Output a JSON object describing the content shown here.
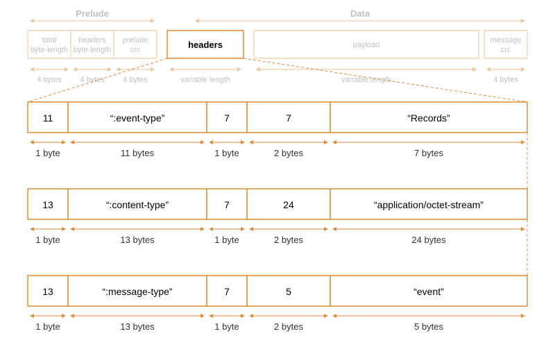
{
  "top": {
    "sections": {
      "prelude": "Prelude",
      "data": "Data"
    },
    "fields": {
      "total": "total\nbyte-length",
      "hdrs": "headers\nbyte-length",
      "pcrc": "prelude\ncrc",
      "headers": "headers",
      "payload": "payload",
      "mcrc": "message\ncrc"
    },
    "sizes": {
      "b4a": "4 bytes",
      "b4b": "4 bytes",
      "b4c": "4 bytes",
      "var1": "variable length",
      "var2": "variable length",
      "b4d": "4 bytes"
    }
  },
  "rows": [
    {
      "cells": [
        "11",
        "“:event-type”",
        "7",
        "7",
        "“Records”"
      ],
      "sizes": [
        "1 byte",
        "11 bytes",
        "1 byte",
        "2 bytes",
        "7 bytes"
      ]
    },
    {
      "cells": [
        "13",
        "“:content-type”",
        "7",
        "24",
        "“application/octet-stream”"
      ],
      "sizes": [
        "1 byte",
        "13 bytes",
        "1 byte",
        "2 bytes",
        "24 bytes"
      ]
    },
    {
      "cells": [
        "13",
        "“:message-type”",
        "7",
        "5",
        "“event”"
      ],
      "sizes": [
        "1 byte",
        "13 bytes",
        "1 byte",
        "2 bytes",
        "5 bytes"
      ]
    }
  ]
}
